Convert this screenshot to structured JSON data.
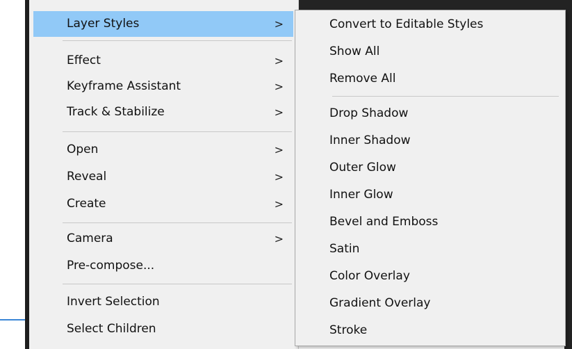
{
  "main_menu": {
    "items": [
      {
        "label": "Layer Styles",
        "has_submenu": true,
        "highlighted": true
      },
      {
        "label": "Effect",
        "has_submenu": true
      },
      {
        "label": "Keyframe Assistant",
        "has_submenu": true
      },
      {
        "label": "Track & Stabilize",
        "has_submenu": true
      },
      {
        "label": "Open",
        "has_submenu": true
      },
      {
        "label": "Reveal",
        "has_submenu": true
      },
      {
        "label": "Create",
        "has_submenu": true
      },
      {
        "label": "Camera",
        "has_submenu": true
      },
      {
        "label": "Pre-compose...",
        "has_submenu": false
      },
      {
        "label": "Invert Selection",
        "has_submenu": false
      },
      {
        "label": "Select Children",
        "has_submenu": false
      }
    ],
    "arrow_glyph": ">"
  },
  "submenu": {
    "items": [
      {
        "label": "Convert to Editable Styles"
      },
      {
        "label": "Show All"
      },
      {
        "label": "Remove All"
      },
      {
        "label": "Drop Shadow"
      },
      {
        "label": "Inner Shadow"
      },
      {
        "label": "Outer Glow"
      },
      {
        "label": "Inner Glow"
      },
      {
        "label": "Bevel and Emboss"
      },
      {
        "label": "Satin"
      },
      {
        "label": "Color Overlay"
      },
      {
        "label": "Gradient Overlay"
      },
      {
        "label": "Stroke"
      }
    ]
  },
  "colors": {
    "menu_bg": "#f0f0f0",
    "highlight": "#91c9f7",
    "separator": "#c8c8c8",
    "dark_background": "#232323"
  }
}
